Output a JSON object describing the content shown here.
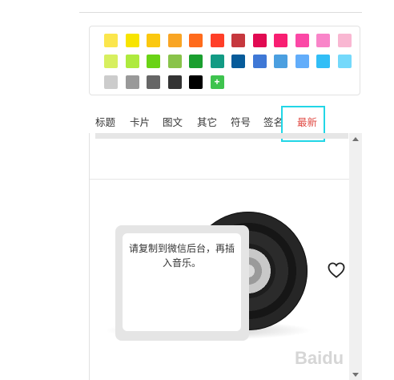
{
  "palette": {
    "rows": [
      [
        "#fbe64d",
        "#f7e400",
        "#fbc80f",
        "#f9a524",
        "#ff6b1c",
        "#ff3f28",
        "#c6383e",
        "#e10a52",
        "#f81f72",
        "#fb48a6",
        "#f985c9",
        "#f9b7d2"
      ],
      [
        "#d7ef5f",
        "#aeea3e",
        "#6ad316",
        "#89c34a",
        "#1a9f2f",
        "#139b84",
        "#075b9a",
        "#3f78d6",
        "#4b9fe0",
        "#62adfa",
        "#32bef6",
        "#74d9fb"
      ],
      [
        "#cccccc",
        "#999999",
        "#666666",
        "#333333",
        "#000000"
      ]
    ],
    "add_label": "+",
    "add_color": "#3ec34e"
  },
  "tabs": [
    {
      "label": "标题"
    },
    {
      "label": "卡片"
    },
    {
      "label": "图文"
    },
    {
      "label": "其它"
    },
    {
      "label": "符号"
    },
    {
      "label": "签名"
    },
    {
      "label": "最新"
    }
  ],
  "active_tab": "最新",
  "accent_color": "#e04a43",
  "highlight_color": "#22d6e6",
  "music_card": {
    "text": "请复制到微信后台，再插入音乐。",
    "favorite_icon": "heart-icon"
  },
  "watermark": {
    "text": "Baidu"
  }
}
